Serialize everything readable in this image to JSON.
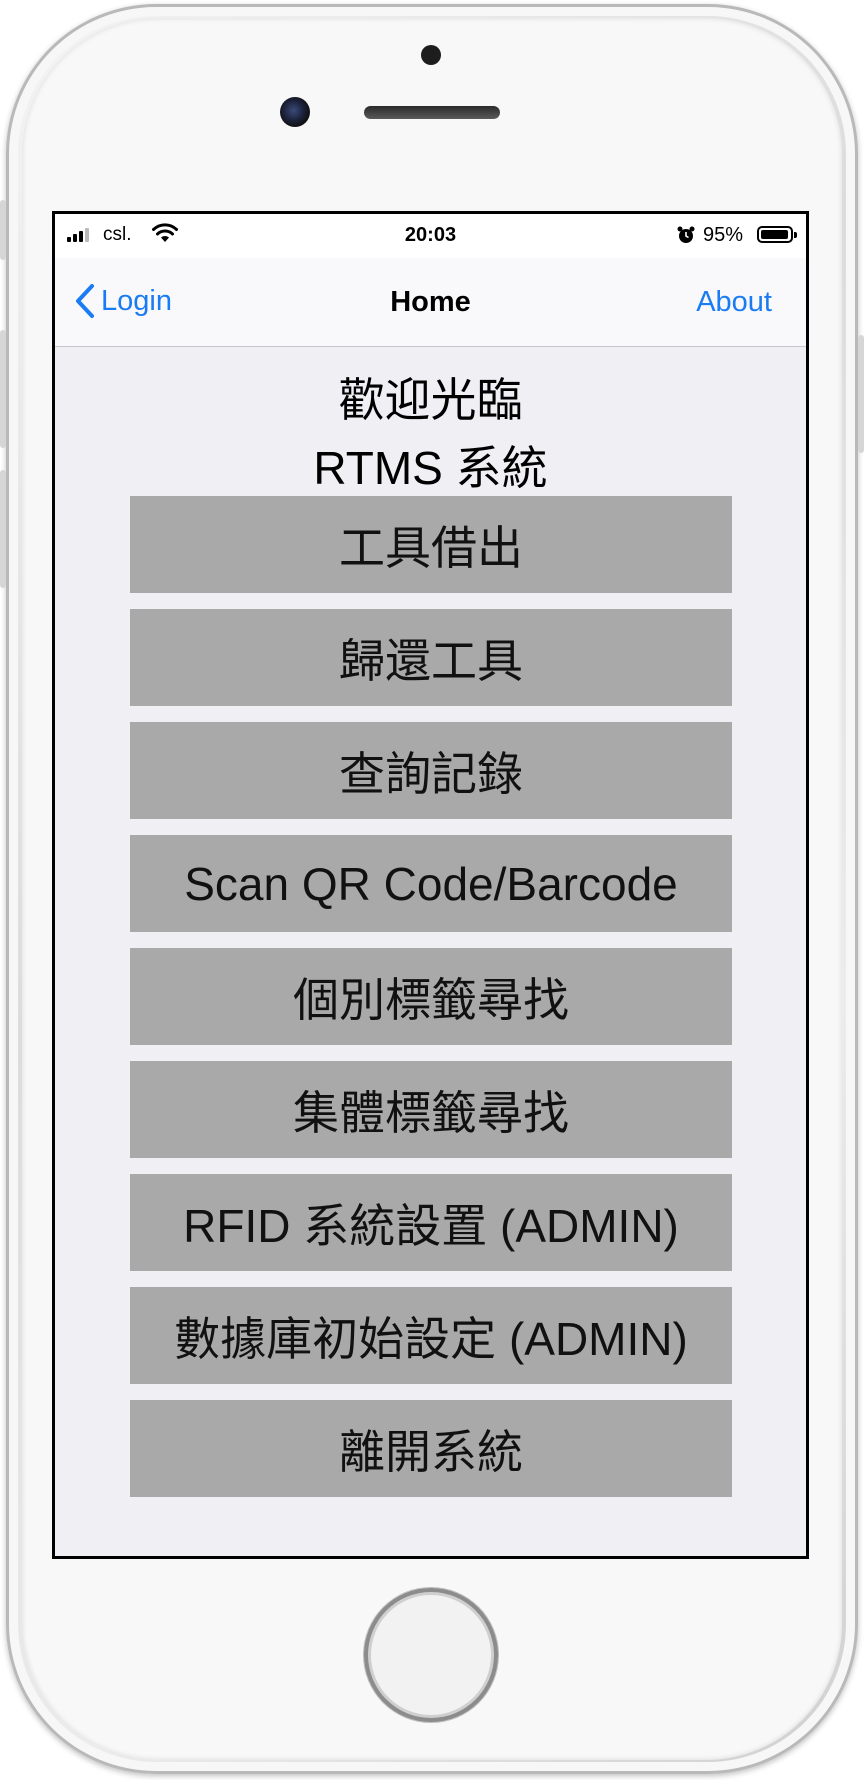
{
  "status_bar": {
    "carrier": "csl.",
    "time": "20:03",
    "battery": "95%",
    "battery_level": 0.95,
    "icons": [
      "signal-icon",
      "wifi-icon",
      "alarm-icon",
      "battery-icon"
    ]
  },
  "nav": {
    "back_label": "Login",
    "title": "Home",
    "right_label": "About",
    "accent": "#1a7cf3"
  },
  "welcome": {
    "line1": "歡迎光臨",
    "line2": "RTMS 系統"
  },
  "menu": [
    {
      "id": "borrow-tool",
      "label": "工具借出"
    },
    {
      "id": "return-tool",
      "label": "歸還工具"
    },
    {
      "id": "query-records",
      "label": "查詢記錄"
    },
    {
      "id": "scan-code",
      "label": "Scan QR Code/Barcode"
    },
    {
      "id": "single-tag-search",
      "label": "個別標籤尋找"
    },
    {
      "id": "group-tag-search",
      "label": "集體標籤尋找"
    },
    {
      "id": "rfid-settings",
      "label": "RFID 系統設置 (ADMIN)"
    },
    {
      "id": "db-init",
      "label": "數據庫初始設定 (ADMIN)"
    },
    {
      "id": "exit-system",
      "label": "離開系統"
    }
  ],
  "colors": {
    "button_bg": "#a9a9a9",
    "screen_bg": "#efeff4"
  }
}
